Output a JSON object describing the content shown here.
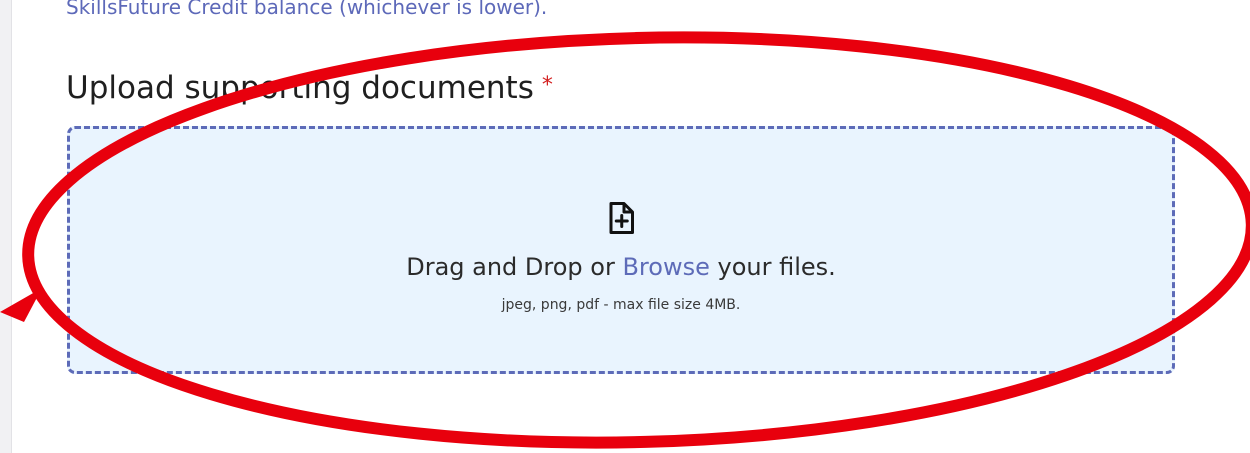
{
  "intro": {
    "credit_note": "SkillsFuture Credit balance (whichever is lower)."
  },
  "upload": {
    "heading": "Upload supporting documents",
    "required_marker": "*",
    "dropzone": {
      "prompt_before": "Drag and Drop or ",
      "browse_label": "Browse",
      "prompt_after": " your files.",
      "hint": "jpeg, png, pdf - max file size 4MB.",
      "icon": "file-plus-icon"
    }
  },
  "colors": {
    "link": "#5d6bb8",
    "dropzone_bg": "#e9f4fe",
    "dropzone_border": "#5d6bb8",
    "required": "#d32020",
    "annotation": "#e8000d"
  }
}
